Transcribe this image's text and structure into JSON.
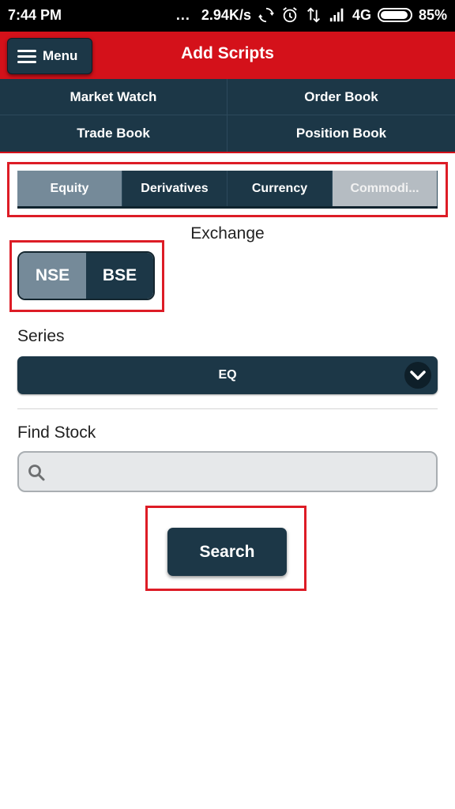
{
  "status_bar": {
    "time": "7:44 PM",
    "dots": "...",
    "speed": "2.94K/s",
    "network": "4G",
    "battery": "85%",
    "icons": [
      "sync-icon",
      "alarm-icon",
      "data-transfer-icon",
      "signal-icon",
      "battery-icon"
    ]
  },
  "header": {
    "menu_label": "Menu",
    "title": "Add Scripts",
    "accent_color": "#d4111a"
  },
  "nav": {
    "items": [
      {
        "label": "Market Watch"
      },
      {
        "label": "Order Book"
      },
      {
        "label": "Trade Book"
      },
      {
        "label": "Position Book"
      }
    ]
  },
  "segments": {
    "tabs": [
      {
        "label": "Equity",
        "state": "active"
      },
      {
        "label": "Derivatives",
        "state": "normal"
      },
      {
        "label": "Currency",
        "state": "normal"
      },
      {
        "label": "Commodi...",
        "state": "disabled"
      }
    ]
  },
  "exchange": {
    "label": "Exchange",
    "options": [
      {
        "label": "NSE",
        "selected": true
      },
      {
        "label": "BSE",
        "selected": false
      }
    ]
  },
  "series": {
    "label": "Series",
    "selected": "EQ"
  },
  "find_stock": {
    "label": "Find Stock",
    "value": "",
    "placeholder": ""
  },
  "search_button": {
    "label": "Search"
  },
  "colors": {
    "primary_dark": "#1c3747",
    "active_tab": "#758a99",
    "highlight_box": "#dd1c26"
  }
}
